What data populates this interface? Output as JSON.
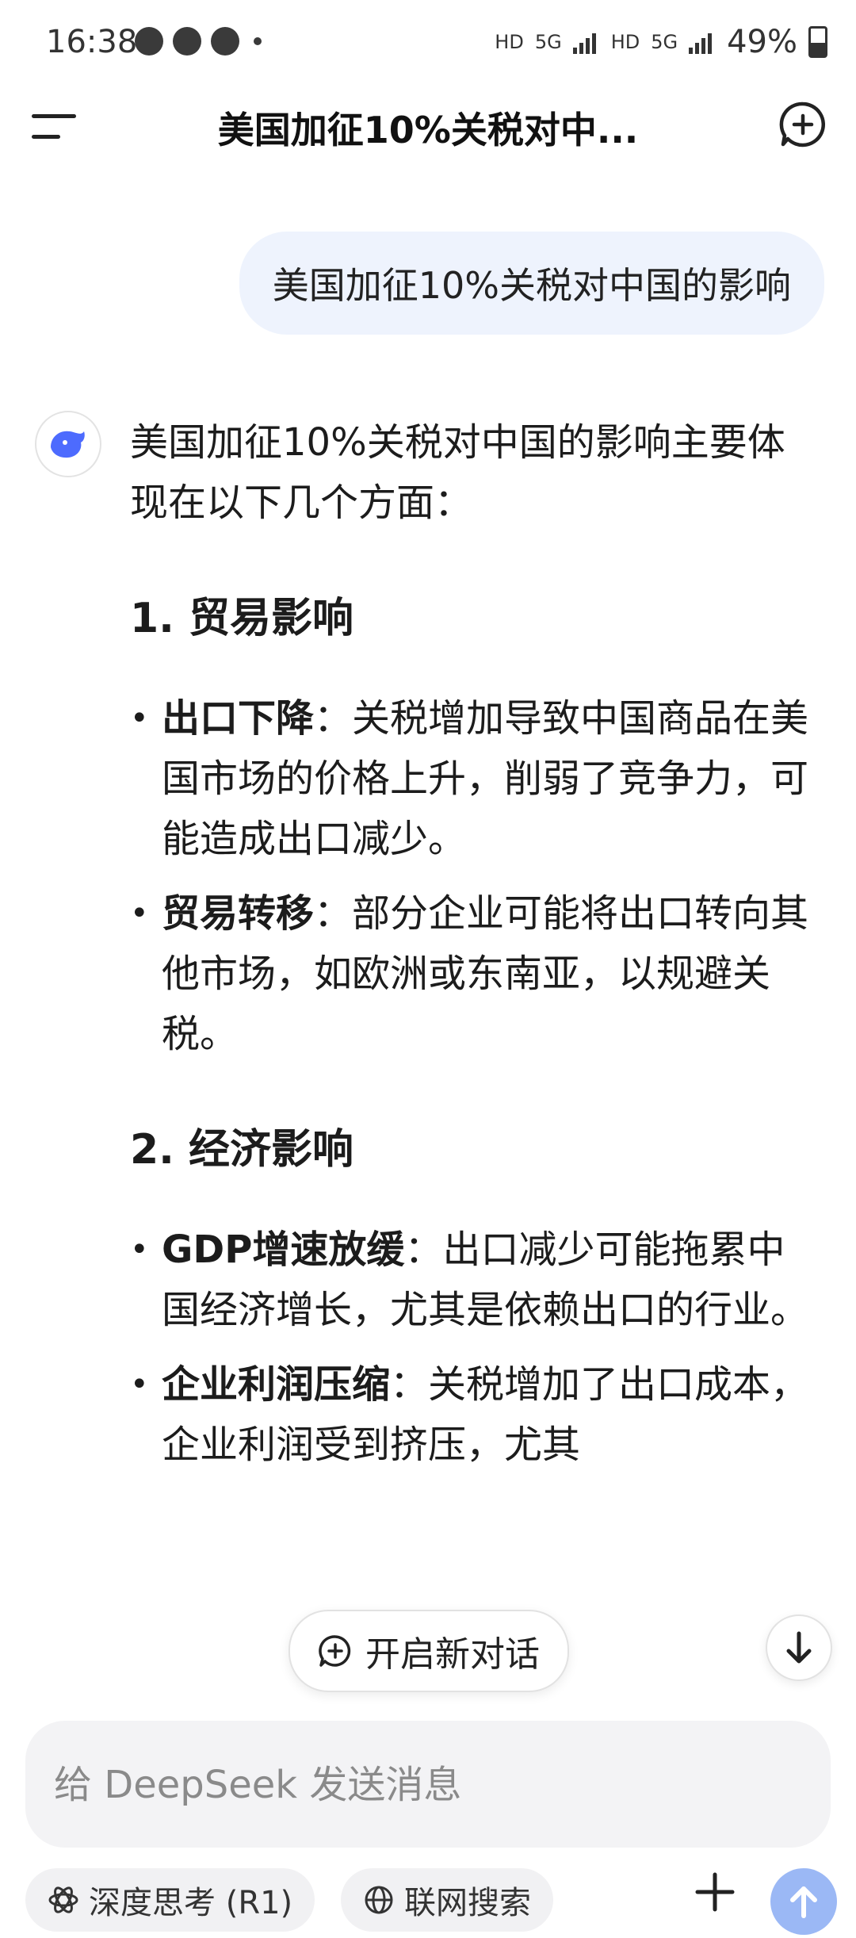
{
  "status_bar": {
    "time": "16:38",
    "net_left": "HD",
    "net_5g_1": "5G",
    "net_right": "HD",
    "net_5g_2": "5G",
    "battery": "49%"
  },
  "header": {
    "title": "美国加征10%关税对中..."
  },
  "user_message": "美国加征10%关税对中国的影响",
  "assistant": {
    "intro": "美国加征10%关税对中国的影响主要体现在以下几个方面：",
    "sections": [
      {
        "title": "1. 贸易影响",
        "bullets": [
          {
            "label": "出口下降",
            "text": "：关税增加导致中国商品在美国市场的价格上升，削弱了竞争力，可能造成出口减少。"
          },
          {
            "label": "贸易转移",
            "text": "：部分企业可能将出口转向其他市场，如欧洲或东南亚，以规避关税。"
          }
        ]
      },
      {
        "title": "2. 经济影响",
        "bullets": [
          {
            "label": "GDP增速放缓",
            "text": "：出口减少可能拖累中国经济增长，尤其是依赖出口的行业。"
          },
          {
            "label": "企业利润压缩",
            "text": "：关税增加了出口成本，企业利润受到挤压，尤其"
          }
        ]
      }
    ]
  },
  "new_chat_pill": "开启新对话",
  "composer": {
    "placeholder": "给 DeepSeek 发送消息"
  },
  "tools": {
    "deep_think": "深度思考 (R1)",
    "web_search": "联网搜索"
  },
  "icons": {
    "menu": "menu-icon",
    "new_chat": "new-chat-icon",
    "scroll_down": "arrow-down-icon",
    "add": "plus-icon",
    "send": "arrow-up-icon"
  },
  "colors": {
    "user_bubble": "#eef3fd",
    "accent": "#4d6bfe",
    "send_disabled": "#9bb8f5"
  }
}
